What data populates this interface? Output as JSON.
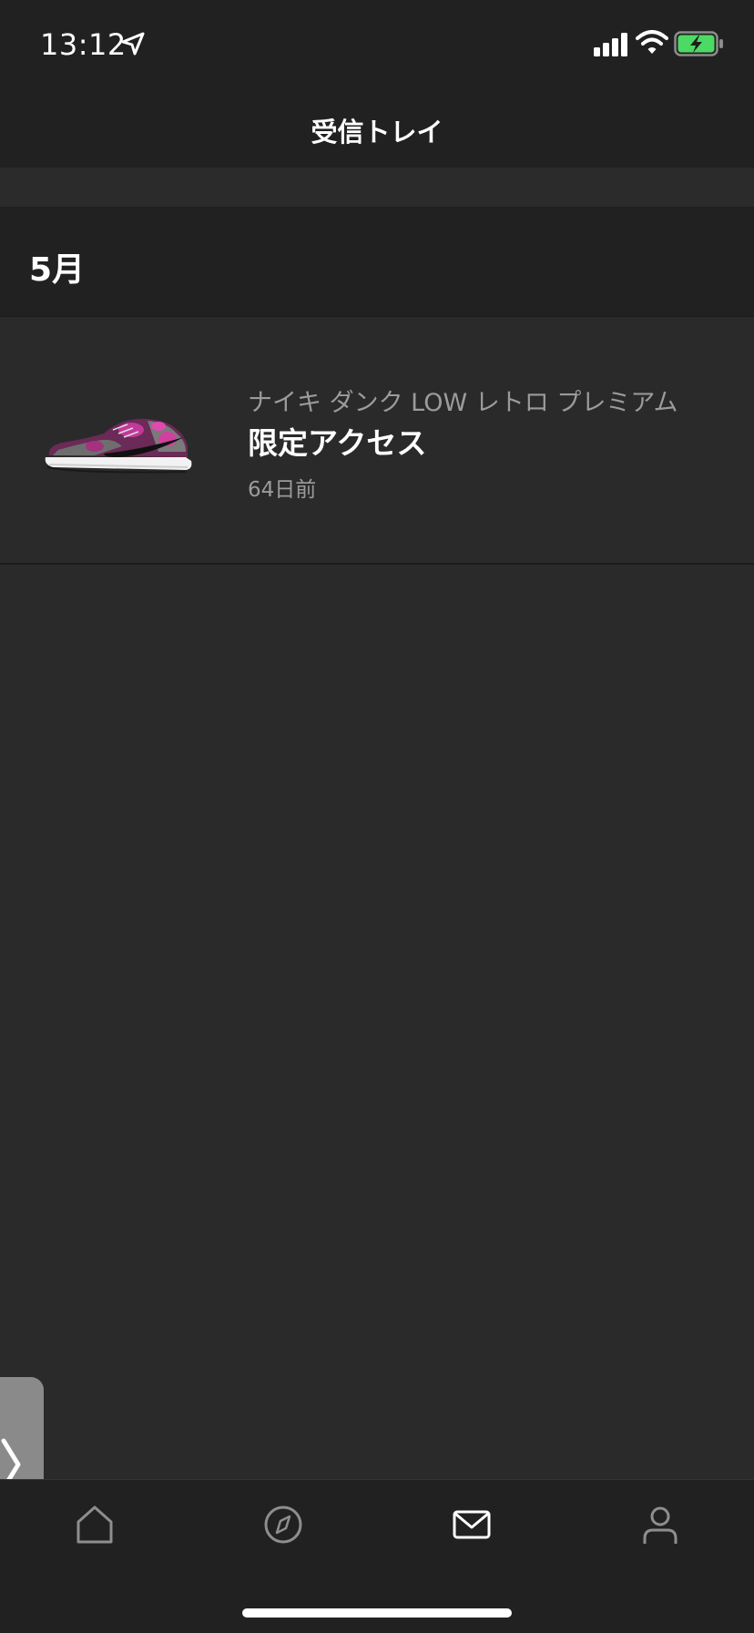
{
  "status_bar": {
    "time": "13:12",
    "icons": [
      "location-arrow-icon",
      "cellular-signal-icon",
      "wifi-icon",
      "battery-charging-icon"
    ],
    "battery_color": "#4cd964"
  },
  "header": {
    "title": "受信トレイ"
  },
  "sections": [
    {
      "title": "5月",
      "items": [
        {
          "subtitle": "ナイキ ダンク LOW レトロ プレミアム",
          "title": "限定アクセス",
          "time": "64日前",
          "image": "sneaker-image"
        }
      ]
    }
  ],
  "side_handle": {
    "icon": "chevron-right-icon"
  },
  "tab_bar": {
    "tabs": [
      {
        "icon": "home-icon",
        "active": false
      },
      {
        "icon": "compass-icon",
        "active": false
      },
      {
        "icon": "inbox-mail-icon",
        "active": true
      },
      {
        "icon": "profile-icon",
        "active": false
      }
    ],
    "active_color": "#ffffff",
    "inactive_color": "#8e8e8e"
  }
}
